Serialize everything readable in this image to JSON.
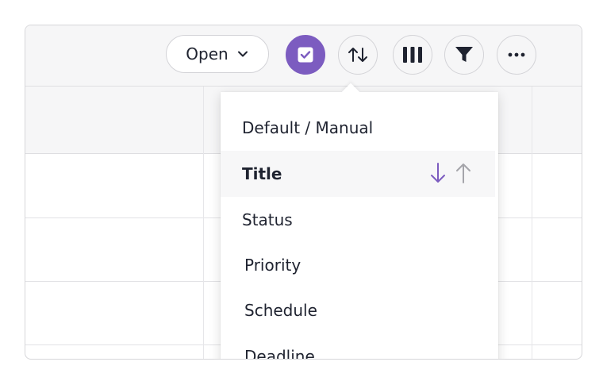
{
  "toolbar": {
    "open_label": "Open",
    "icons": [
      "chevron-down-icon",
      "checkbox-icon",
      "sort-icon",
      "columns-icon",
      "filter-icon",
      "more-icon"
    ]
  },
  "sort_menu": {
    "items": [
      {
        "label": "Default / Manual",
        "selected": false
      },
      {
        "label": "Title",
        "selected": true
      },
      {
        "label": "Status",
        "selected": false
      },
      {
        "label": "Priority",
        "selected": false
      },
      {
        "label": "Schedule",
        "selected": false
      },
      {
        "label": "Deadline",
        "selected": false
      }
    ]
  },
  "colors": {
    "accent": "#7c5cc0",
    "text": "#1f2330",
    "muted": "#a5a5aa",
    "toolbar_bg": "#f6f6f7",
    "border": "#d3d3d7"
  }
}
